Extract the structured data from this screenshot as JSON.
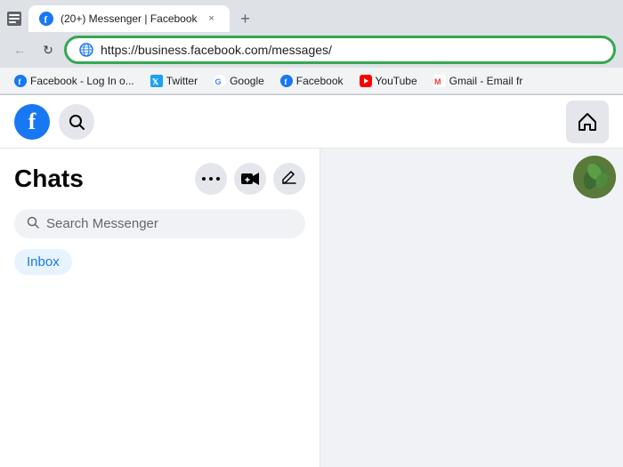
{
  "browser": {
    "tab": {
      "title": "(20+) Messenger | Facebook",
      "close_label": "×"
    },
    "new_tab_label": "+",
    "nav": {
      "back_label": "←",
      "forward_label": "→",
      "reload_label": "↻"
    },
    "address_bar": {
      "url": "https://business.facebook.com/messages/"
    },
    "bookmarks": [
      {
        "label": "Facebook - Log In o...",
        "color": "#1877f2"
      },
      {
        "label": "Twitter",
        "color": "#1da1f2"
      },
      {
        "label": "Google",
        "color": "#4285f4"
      },
      {
        "label": "Facebook",
        "color": "#1877f2"
      },
      {
        "label": "YouTube",
        "color": "#ff0000"
      },
      {
        "label": "Gmail - Email fr",
        "color": "#ea4335"
      }
    ]
  },
  "messenger": {
    "nav": {
      "search_tooltip": "Search"
    },
    "chats_title": "Chats",
    "buttons": {
      "more_label": "•••",
      "video_label": "📹",
      "compose_label": "✎"
    },
    "search": {
      "placeholder": "Search Messenger"
    },
    "inbox_label": "Inbox"
  }
}
